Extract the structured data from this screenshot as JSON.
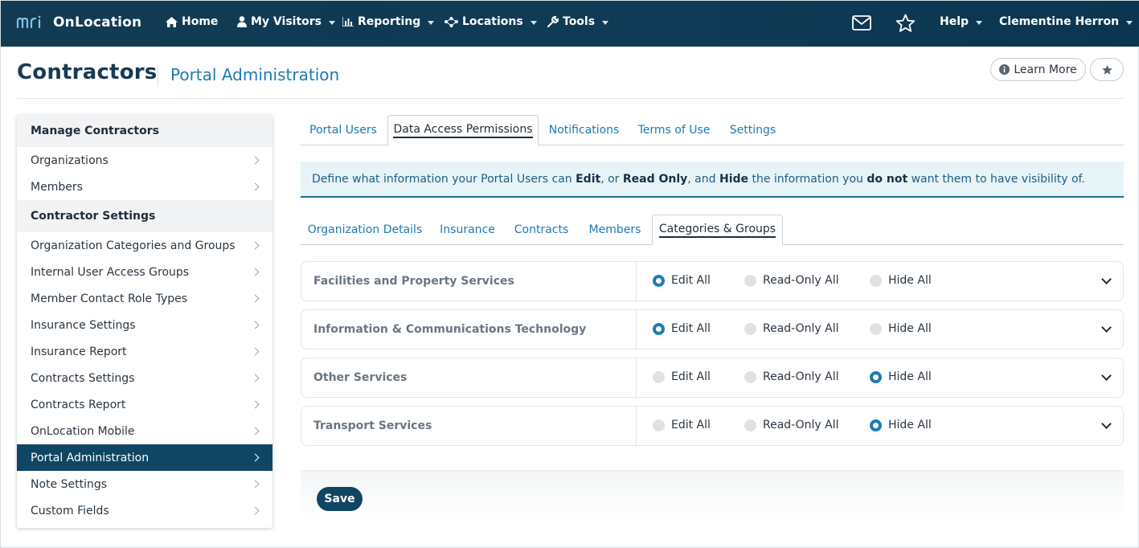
{
  "topnav": {
    "brand": "OnLocation",
    "items": [
      {
        "label": "Home"
      },
      {
        "label": "My Visitors"
      },
      {
        "label": "Reporting"
      },
      {
        "label": "Locations"
      },
      {
        "label": "Tools"
      }
    ],
    "help": "Help",
    "user": "Clementine Herron",
    "icons": [
      "mail-icon",
      "star-icon"
    ]
  },
  "header": {
    "title": "Contractors",
    "subtitle": "Portal Administration",
    "learn_more": "Learn More"
  },
  "sidebar": {
    "sections": [
      {
        "title": "Manage Contractors",
        "items": [
          {
            "label": "Organizations"
          },
          {
            "label": "Members"
          }
        ]
      },
      {
        "title": "Contractor Settings",
        "items": [
          {
            "label": "Organization Categories and Groups"
          },
          {
            "label": "Internal User Access Groups"
          },
          {
            "label": "Member Contact Role Types"
          },
          {
            "label": "Insurance Settings"
          },
          {
            "label": "Insurance Report"
          },
          {
            "label": "Contracts Settings"
          },
          {
            "label": "Contracts Report"
          },
          {
            "label": "OnLocation Mobile"
          },
          {
            "label": "Portal Administration",
            "active": true
          },
          {
            "label": "Note Settings"
          },
          {
            "label": "Custom Fields"
          }
        ]
      }
    ]
  },
  "tabs": [
    {
      "label": "Portal Users"
    },
    {
      "label": "Data Access Permissions",
      "active": true
    },
    {
      "label": "Notifications"
    },
    {
      "label": "Terms of Use"
    },
    {
      "label": "Settings"
    }
  ],
  "banner": {
    "p1": "Define what information your Portal Users can ",
    "b1": "Edit",
    "p2": ", or ",
    "b2": "Read Only",
    "p3": ", and ",
    "b3": "Hide",
    "p4": " the information you ",
    "b4": "do not",
    "p5": " want them to have visibility of."
  },
  "subtabs": [
    {
      "label": "Organization Details"
    },
    {
      "label": "Insurance"
    },
    {
      "label": "Contracts"
    },
    {
      "label": "Members"
    },
    {
      "label": "Categories & Groups",
      "active": true
    }
  ],
  "permission_options": [
    "Edit All",
    "Read-Only All",
    "Hide All"
  ],
  "categories": [
    {
      "name": "Facilities and Property Services",
      "selected": "Edit All"
    },
    {
      "name": "Information & Communications Technology",
      "selected": "Edit All"
    },
    {
      "name": "Other Services",
      "selected": "Hide All"
    },
    {
      "name": "Transport Services",
      "selected": "Hide All"
    }
  ],
  "footer": {
    "save": "Save"
  },
  "colors": {
    "navbar": "#0f3b56",
    "accent": "#1c7ab5",
    "active_item": "#0f4663"
  }
}
